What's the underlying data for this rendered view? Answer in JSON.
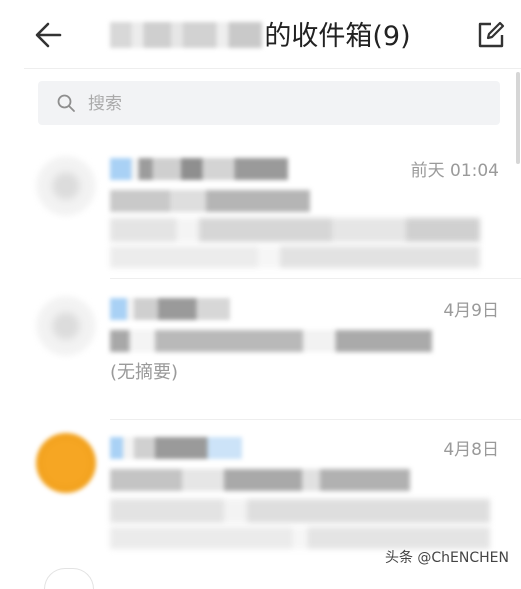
{
  "header": {
    "title_suffix": "的收件箱(9)",
    "back_icon": "arrow-left-icon",
    "compose_icon": "compose-icon"
  },
  "search": {
    "placeholder": "搜索",
    "icon": "search-icon"
  },
  "mails": [
    {
      "time": "前天 01:04"
    },
    {
      "time": "4月9日",
      "summary": "(无摘要)"
    },
    {
      "time": "4月8日"
    }
  ],
  "watermark": "头条 @ChENCHEN",
  "colors": {
    "background": "#ffffff",
    "search_bg": "#f2f3f5",
    "time_text": "#9a9a9a",
    "avatar_orange": "#f6a623",
    "unread_blue": "#a9d1f5"
  }
}
